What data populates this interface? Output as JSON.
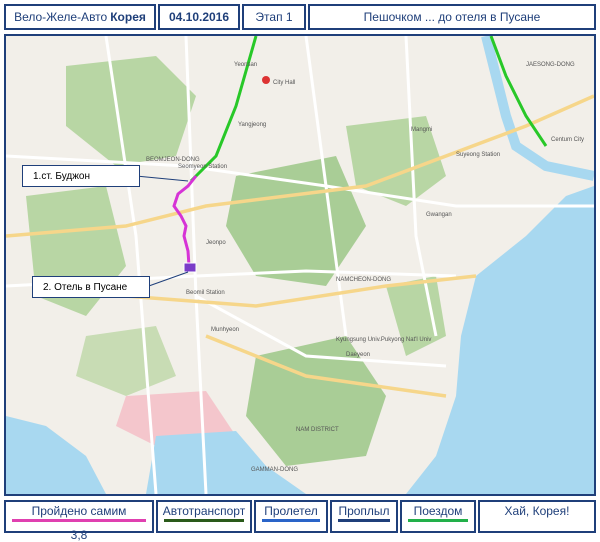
{
  "header": {
    "title_prefix": "Вело-Желе-Авто",
    "title_country": "Корея",
    "date": "04.10.2016",
    "stage": "Этап 1",
    "route": "Пешочком ... до отеля в Пусане"
  },
  "map": {
    "callouts": [
      {
        "label": "1.ст. Буджон"
      },
      {
        "label": "2. Отель в Пусане"
      }
    ],
    "place_labels": {
      "jaesong": "JAESONG-DONG",
      "city_hall": "City Hall",
      "yeonsan": "Yeonsan",
      "beomjeon": "BEOMJEON-DONG",
      "seomyeon": "Seomyeon Station",
      "munhyeon": "Munhyeon",
      "nam_district": "NAM DISTRICT",
      "gammandong": "GAMMAN-DONG",
      "centum": "Centum City",
      "gwangan": "Gwangan",
      "kyungsung": "Kyungsung Univ.Pukyong Nat'l Univ",
      "daeyeon": "Daeyeon",
      "suyeong": "Suyeong Station",
      "mangmi": "Mangmi",
      "namcheon": "NAMCHEON-DONG",
      "yangjeong": "Yangjeong",
      "jeonpo": "Jeonpo",
      "beomil": "Beomil Station"
    },
    "colors": {
      "walk_route": "#d633d6",
      "rail": "#28c828",
      "sea": "#a8d8f0",
      "land": "#f2efe9",
      "park": "#b8d6a4",
      "port": "#f4c6cc"
    }
  },
  "footer": {
    "walked_label": "Пройдено самим",
    "walked_distance": "3,8",
    "auto_label": "Автотранспорт",
    "flight_label": "Пролетел",
    "sail_label": "Проплыл",
    "train_label": "Поездом",
    "greeting": "Хай, Корея!",
    "colors": {
      "walked": "#e040b0",
      "auto": "#2a5a1a",
      "flight": "#2a64c8",
      "sail": "#1f3f7a",
      "train": "#22b04a"
    }
  }
}
